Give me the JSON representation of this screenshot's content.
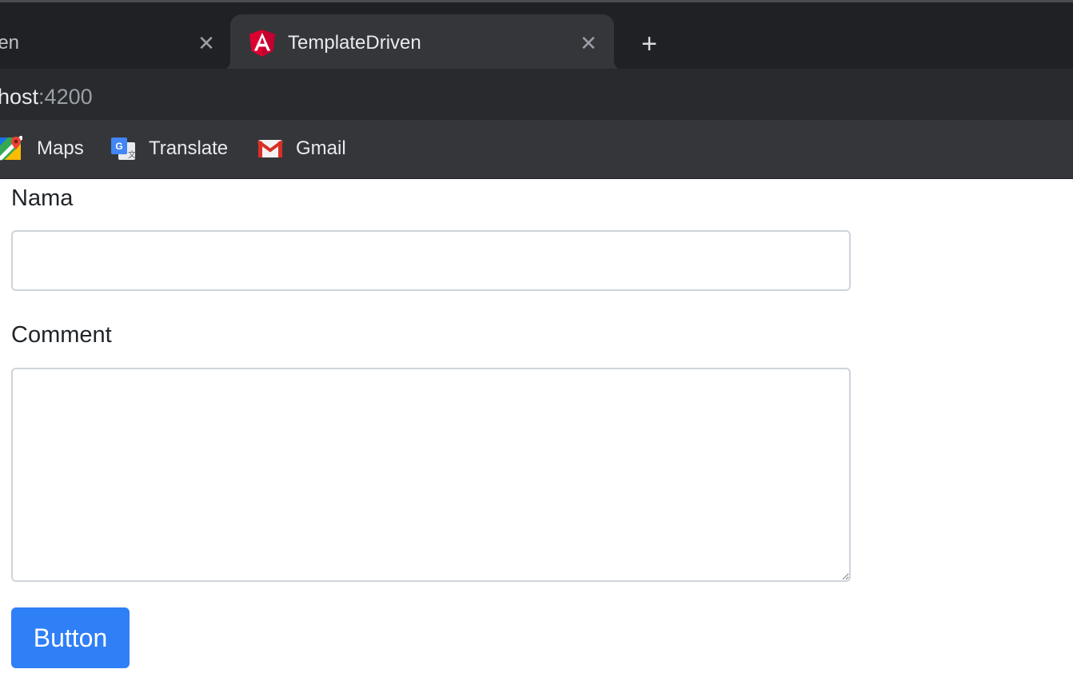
{
  "browser": {
    "tabs": [
      {
        "title": "TemplateDriven",
        "visible_fragment": "riven",
        "active": false,
        "close_icon": "close-icon"
      },
      {
        "title": "TemplateDriven",
        "active": true,
        "favicon": "angular-icon",
        "close_icon": "close-icon"
      }
    ],
    "new_tab_symbol": "+",
    "address": {
      "host": "host",
      "port": ":4200"
    },
    "bookmarks": [
      {
        "label": "Maps",
        "icon": "google-maps-icon"
      },
      {
        "label": "Translate",
        "icon": "google-translate-icon"
      },
      {
        "label": "Gmail",
        "icon": "gmail-icon"
      }
    ],
    "colors": {
      "tabbar": "#202124",
      "active_tab": "#35363a",
      "toolbar": "#282a2e"
    }
  },
  "form": {
    "nama_label": "Nama",
    "nama_value": "",
    "comment_label": "Comment",
    "comment_value": "",
    "button_label": "Button",
    "button_color": "#2f7ff6"
  }
}
